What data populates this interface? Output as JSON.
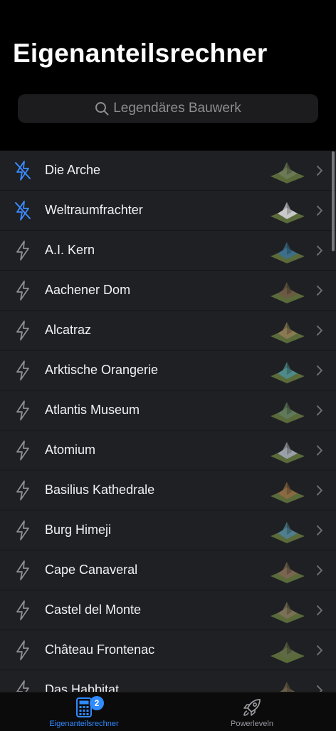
{
  "header": {
    "title": "Eigenanteilsrechner",
    "search_placeholder": "Legendäres Bauwerk"
  },
  "list": {
    "items": [
      {
        "label": "Die Arche",
        "icon": "bolt-slash-icon",
        "highlighted": true
      },
      {
        "label": "Weltraumfrachter",
        "icon": "bolt-slash-icon",
        "highlighted": true
      },
      {
        "label": "A.I. Kern",
        "icon": "bolt-icon",
        "highlighted": false
      },
      {
        "label": "Aachener Dom",
        "icon": "bolt-icon",
        "highlighted": false
      },
      {
        "label": "Alcatraz",
        "icon": "bolt-icon",
        "highlighted": false
      },
      {
        "label": "Arktische Orangerie",
        "icon": "bolt-icon",
        "highlighted": false
      },
      {
        "label": "Atlantis Museum",
        "icon": "bolt-icon",
        "highlighted": false
      },
      {
        "label": "Atomium",
        "icon": "bolt-icon",
        "highlighted": false
      },
      {
        "label": "Basilius Kathedrale",
        "icon": "bolt-icon",
        "highlighted": false
      },
      {
        "label": "Burg Himeji",
        "icon": "bolt-icon",
        "highlighted": false
      },
      {
        "label": "Cape Canaveral",
        "icon": "bolt-icon",
        "highlighted": false
      },
      {
        "label": "Castel del Monte",
        "icon": "bolt-icon",
        "highlighted": false
      },
      {
        "label": "Château Frontenac",
        "icon": "bolt-icon",
        "highlighted": false
      },
      {
        "label": "Das Habbitat",
        "icon": "bolt-icon",
        "highlighted": false
      }
    ]
  },
  "tabbar": {
    "tabs": [
      {
        "label": "Eigenanteilsrechner",
        "icon": "calculator-icon",
        "badge": "2",
        "active": true
      },
      {
        "label": "Powerleveln",
        "icon": "rocket-icon",
        "active": false
      }
    ]
  },
  "colors": {
    "accent": "#2f8bff",
    "background": "#000000",
    "row_background": "#1f2023",
    "muted_text": "#8e8e93"
  }
}
